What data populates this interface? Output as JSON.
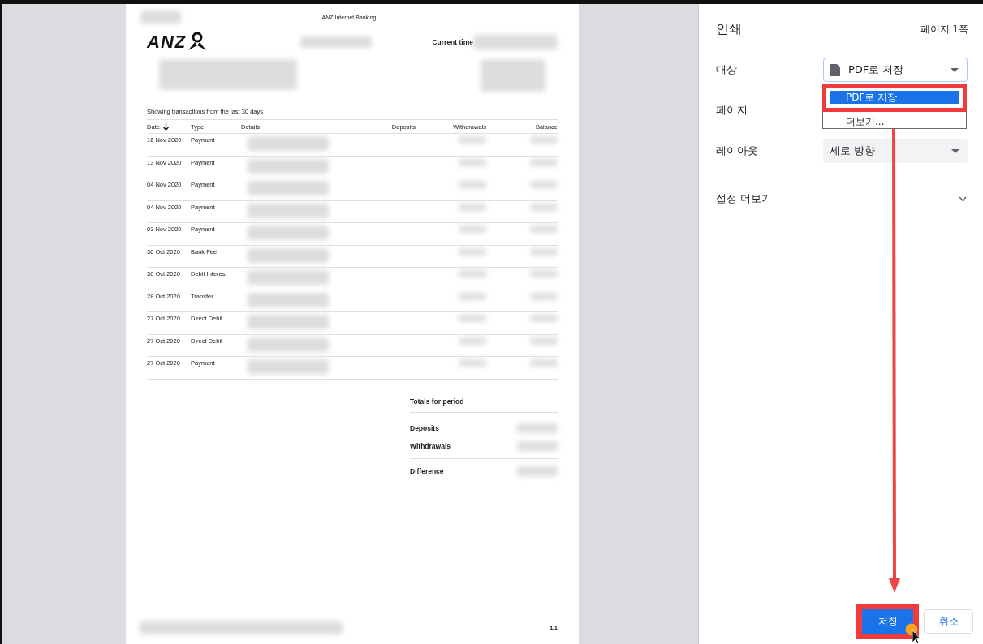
{
  "preview": {
    "header_title": "ANZ Internet Banking",
    "logo_text": "ANZ",
    "current_time_label": "Current time",
    "caption": "Showing transactions from the last 30 days",
    "columns": [
      {
        "label": "Date",
        "sorted": true
      },
      {
        "label": "Type",
        "sorted": false
      },
      {
        "label": "Details",
        "sorted": false
      },
      {
        "label": "Deposits",
        "sorted": false
      },
      {
        "label": "Withdrawals",
        "sorted": false
      },
      {
        "label": "Balance",
        "sorted": false
      }
    ],
    "rows": [
      {
        "date": "16 Nov 2020",
        "type": "Payment"
      },
      {
        "date": "13 Nov 2020",
        "type": "Payment"
      },
      {
        "date": "04 Nov 2020",
        "type": "Payment"
      },
      {
        "date": "04 Nov 2020",
        "type": "Payment"
      },
      {
        "date": "03 Nov 2020",
        "type": "Payment"
      },
      {
        "date": "30 Oct 2020",
        "type": "Bank Fee"
      },
      {
        "date": "30 Oct 2020",
        "type": "Debit Interest"
      },
      {
        "date": "28 Oct 2020",
        "type": "Transfer"
      },
      {
        "date": "27 Oct 2020",
        "type": "Direct Debit"
      },
      {
        "date": "27 Oct 2020",
        "type": "Direct Debit"
      },
      {
        "date": "27 Oct 2020",
        "type": "Payment"
      }
    ],
    "totals": {
      "title": "Totals for period",
      "lines": [
        {
          "label": "Deposits"
        },
        {
          "label": "Withdrawals"
        },
        {
          "label": "Difference"
        }
      ]
    },
    "page_number": "1/1"
  },
  "print_panel": {
    "title": "인쇄",
    "page_count": "페이지 1쪽",
    "fields": [
      {
        "label": "대상",
        "kind": "destination",
        "value": "PDF로 저장"
      },
      {
        "label": "페이지",
        "kind": "covered"
      },
      {
        "label": "레이아웃",
        "kind": "select",
        "value": "세로 방향"
      }
    ],
    "dropdown_options": [
      {
        "label": "PDF로 저장",
        "selected": true
      },
      {
        "label": "더보기...",
        "selected": false
      }
    ],
    "more_settings": "설정 더보기",
    "buttons": [
      {
        "label": "저장",
        "kind": "primary"
      },
      {
        "label": "취소",
        "kind": "secondary"
      }
    ]
  }
}
